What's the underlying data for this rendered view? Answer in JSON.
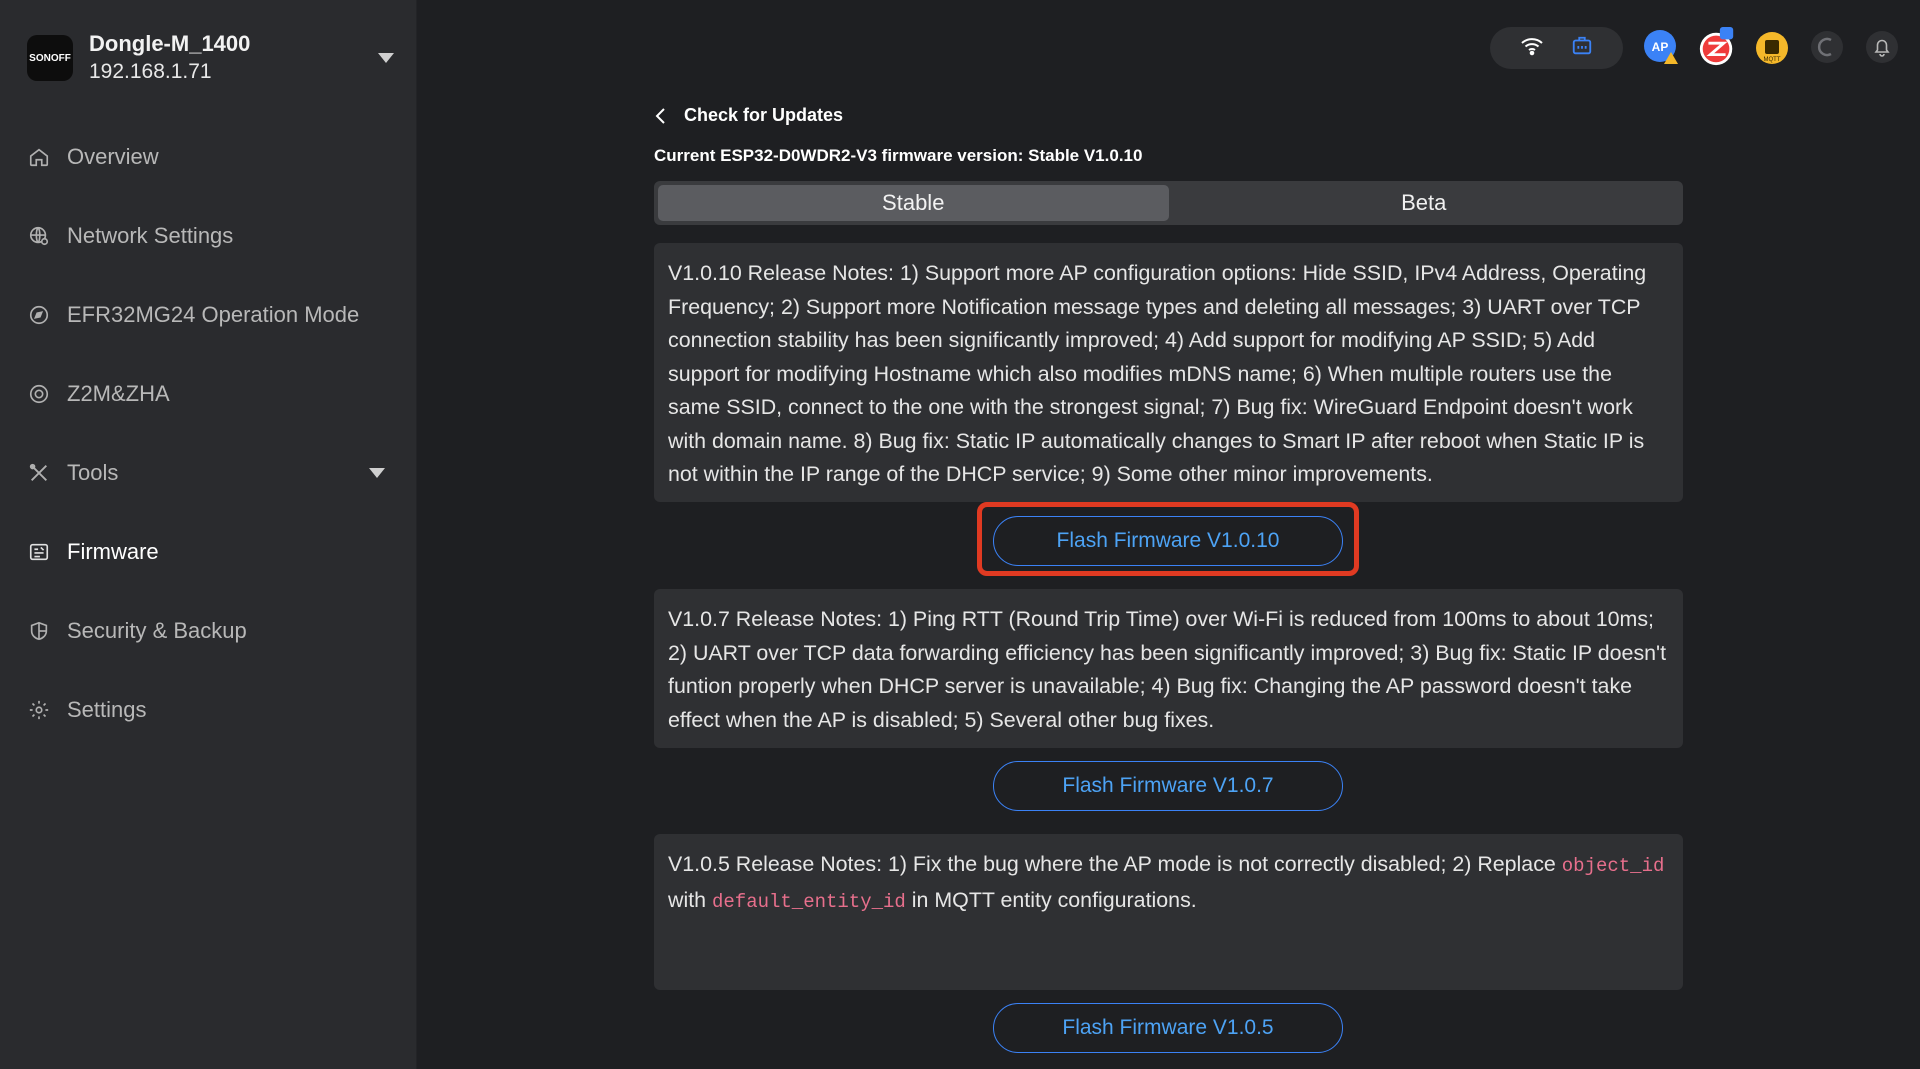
{
  "device": {
    "logo_text": "SONOFF",
    "name": "Dongle-M_1400",
    "ip": "192.168.1.71"
  },
  "sidebar": {
    "items": [
      {
        "label": "Overview",
        "icon": "home-icon"
      },
      {
        "label": "Network Settings",
        "icon": "globe-settings-icon"
      },
      {
        "label": "EFR32MG24 Operation Mode",
        "icon": "compass-icon"
      },
      {
        "label": "Z2M&ZHA",
        "icon": "target-icon"
      },
      {
        "label": "Tools",
        "icon": "tools-icon"
      },
      {
        "label": "Firmware",
        "icon": "firmware-icon",
        "active": true
      },
      {
        "label": "Security & Backup",
        "icon": "shield-icon"
      },
      {
        "label": "Settings",
        "icon": "gear-icon"
      }
    ]
  },
  "topbar": {
    "icons": [
      "wifi-icon",
      "ethernet-icon",
      "ap-mode-warning-icon",
      "zigbee-icon",
      "mqtt-icon",
      "refresh-icon",
      "bell-icon"
    ],
    "colors": {
      "ap": "#3b82f6",
      "zigbee": "#ef3b3b",
      "mqtt": "#f5b82a"
    }
  },
  "main": {
    "back_label": "Check for Updates",
    "current_version": "Current ESP32-D0WDR2-V3 firmware version: Stable V1.0.10",
    "tabs": [
      {
        "label": "Stable",
        "active": true
      },
      {
        "label": "Beta",
        "active": false
      }
    ],
    "releases": [
      {
        "notes": "V1.0.10 Release Notes: 1) Support more AP configuration options: Hide SSID, IPv4 Address, Operating Frequency; 2) Support more Notification message types and deleting all messages; 3) UART over TCP connection stability has been significantly improved; 4) Add support for modifying AP SSID; 5) Add support for modifying Hostname which also modifies mDNS name; 6) When multiple routers use the same SSID, connect to the one with the strongest signal; 7) Bug fix: WireGuard Endpoint doesn't work with domain name. 8) Bug fix: Static IP automatically changes to Smart IP after reboot when Static IP is not within the IP range of the DHCP service; 9) Some other minor improvements.",
        "button": "Flash Firmware V1.0.10"
      },
      {
        "notes": "V1.0.7 Release Notes: 1) Ping RTT (Round Trip Time) over Wi-Fi is reduced from 100ms to about 10ms; 2) UART over TCP data forwarding efficiency has been significantly improved; 3) Bug fix: Static IP doesn't funtion properly when DHCP server is unavailable; 4) Bug fix: Changing the AP password doesn't take effect when the AP is disabled; 5) Several other bug fixes.",
        "button": "Flash Firmware V1.0.7"
      },
      {
        "notes_pre": "V1.0.5 Release Notes: 1) Fix the bug where the AP mode is not correctly disabled; 2) Replace ",
        "code1": "object_id",
        "notes_mid": " with ",
        "code2": "default_entity_id",
        "notes_post": " in MQTT entity configurations.",
        "button": "Flash Firmware V1.0.5"
      }
    ]
  },
  "colors": {
    "accent": "#4da3f5",
    "highlight": "#e03a22",
    "code": "#e76f8c"
  }
}
